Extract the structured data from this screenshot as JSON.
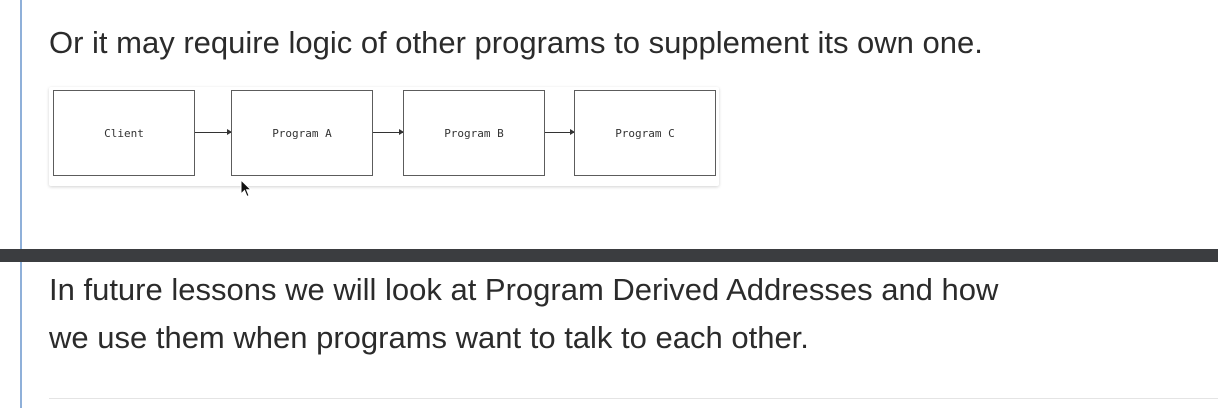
{
  "content": {
    "paragraph_top": "Or it may require logic of other programs to supplement its own one.",
    "paragraph_bottom_line1": "In future lessons we will look at Program Derived Addresses and how",
    "paragraph_bottom_line2": "we use them when programs want to talk to each other."
  },
  "diagram": {
    "nodes": [
      "Client",
      "Program A",
      "Program B",
      "Program C"
    ]
  },
  "icons": {
    "cursor": "mouse-pointer-icon",
    "arrow": "arrow-right-icon"
  },
  "colors": {
    "accent_rule": "#8fb0d9",
    "divider": "#3b3d40",
    "text": "#2b2b2b"
  }
}
